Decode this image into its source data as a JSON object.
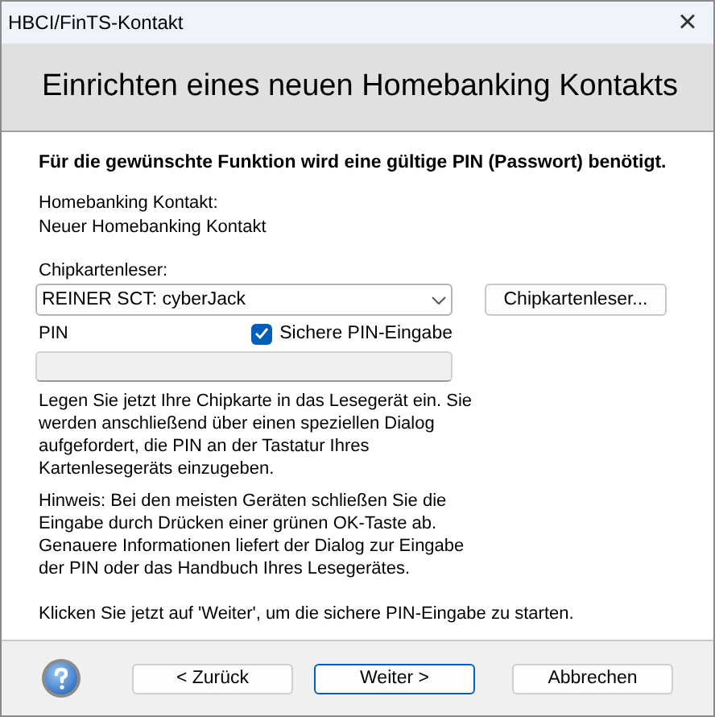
{
  "window": {
    "title": "HBCI/FinTS-Kontakt",
    "close": "×"
  },
  "header": {
    "title": "Einrichten eines neuen Homebanking Kontakts"
  },
  "intro": "Für die gewünschte Funktion wird eine gültige PIN (Passwort) benötigt.",
  "contact": {
    "label": "Homebanking Kontakt:",
    "value": "Neuer Homebanking Kontakt"
  },
  "reader": {
    "label": "Chipkartenleser:",
    "value": "REINER SCT: cyberJack",
    "button": "Chipkartenleser..."
  },
  "pin": {
    "label": "PIN",
    "secure_entry": {
      "label": "Sichere PIN-Eingabe",
      "checked": true
    },
    "disabled": true
  },
  "paragraphs": [
    {
      "lines": [
        "Legen Sie jetzt Ihre Chipkarte in das Lesegerät ein. Sie",
        "werden anschließend über einen speziellen Dialog",
        "aufgefordert, die PIN an der Tastatur Ihres",
        "Kartenlesegeräts einzugeben."
      ]
    },
    {
      "lines": [
        "Hinweis: Bei den meisten Geräten schließen Sie die",
        "Eingabe durch Drücken einer grünen OK-Taste ab.",
        "Genauere Informationen liefert der Dialog zur Eingabe",
        "der PIN oder das Handbuch Ihres Lesegerätes."
      ]
    },
    {
      "lines": [
        "Klicken Sie jetzt auf 'Weiter', um die sichere PIN-Eingabe zu starten."
      ]
    }
  ],
  "buttons": [
    {
      "label": "< Zurück",
      "default": false
    },
    {
      "label": "Weiter >",
      "default": true
    },
    {
      "label": "Abbrechen",
      "default": false
    }
  ]
}
